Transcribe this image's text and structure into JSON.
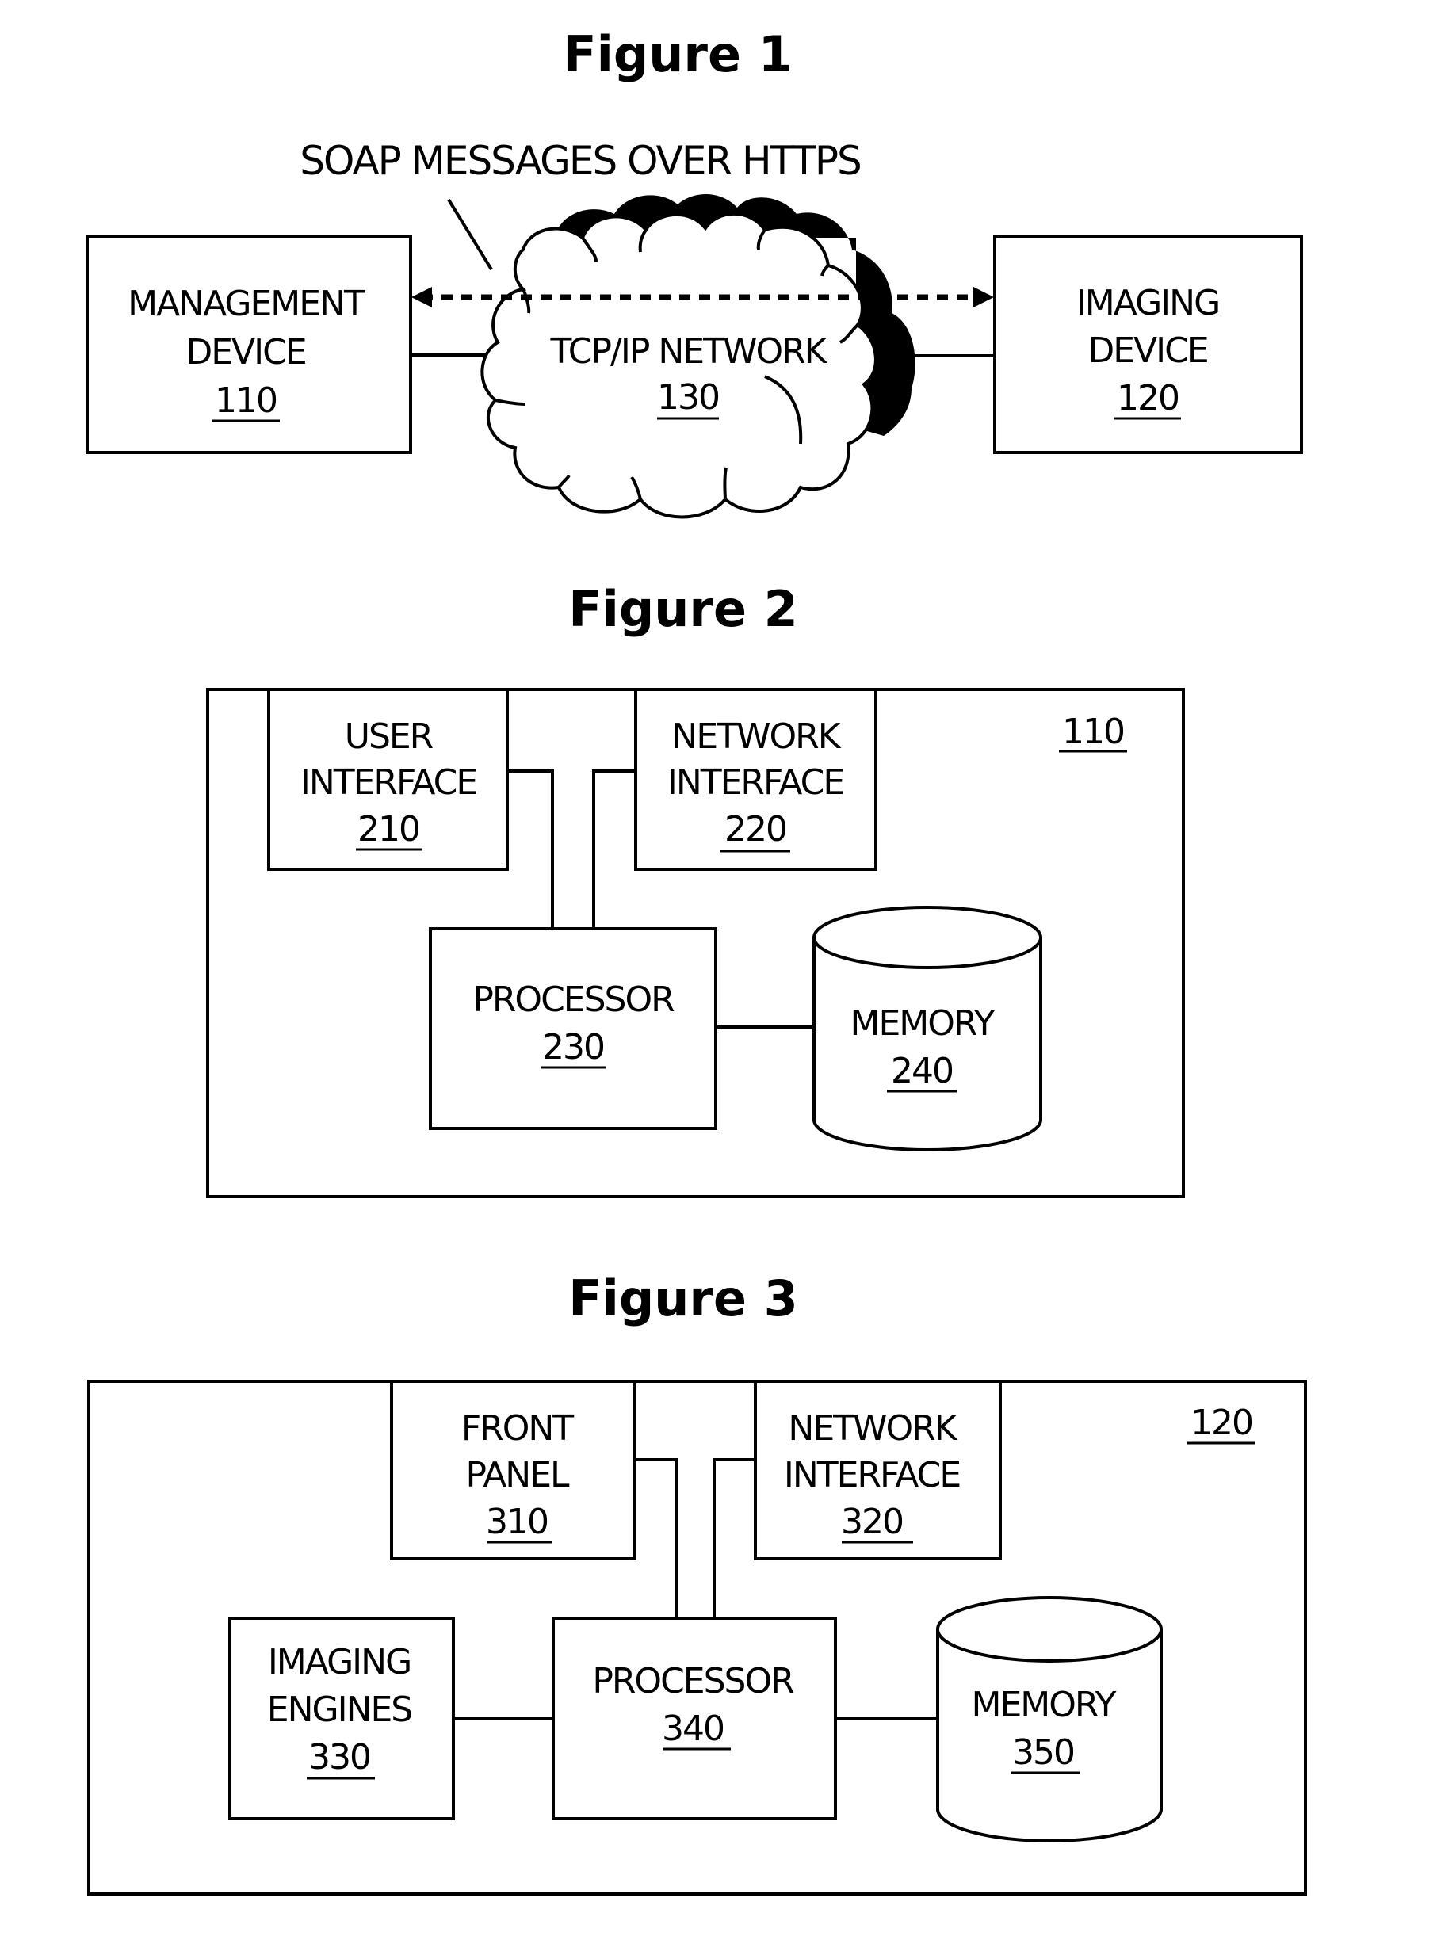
{
  "figures": [
    {
      "title": "Figure 1",
      "annotation": "SOAP MESSAGES OVER HTTPS",
      "nodes": {
        "management_device": {
          "lines": [
            "MANAGEMENT",
            "DEVICE"
          ],
          "ref": "110"
        },
        "network": {
          "lines": [
            "TCP/IP NETWORK"
          ],
          "ref": "130"
        },
        "imaging_device": {
          "lines": [
            "IMAGING",
            "DEVICE"
          ],
          "ref": "120"
        }
      },
      "connections": [
        {
          "from": "management_device",
          "to": "imaging_device",
          "style": "dashed",
          "arrows": "both",
          "meaning": "SOAP MESSAGES OVER HTTPS"
        },
        {
          "from": "management_device",
          "to": "network",
          "style": "solid"
        },
        {
          "from": "network",
          "to": "imaging_device",
          "style": "solid"
        }
      ]
    },
    {
      "title": "Figure 2",
      "container_ref": "110",
      "nodes": {
        "user_interface": {
          "lines": [
            "USER",
            "INTERFACE"
          ],
          "ref": "210"
        },
        "network_interface": {
          "lines": [
            "NETWORK",
            "INTERFACE"
          ],
          "ref": "220"
        },
        "processor": {
          "lines": [
            "PROCESSOR"
          ],
          "ref": "230"
        },
        "memory": {
          "lines": [
            "MEMORY"
          ],
          "ref": "240"
        }
      },
      "connections": [
        {
          "from": "user_interface",
          "to": "processor"
        },
        {
          "from": "network_interface",
          "to": "processor"
        },
        {
          "from": "processor",
          "to": "memory"
        }
      ]
    },
    {
      "title": "Figure 3",
      "container_ref": "120",
      "nodes": {
        "front_panel": {
          "lines": [
            "FRONT",
            "PANEL"
          ],
          "ref": "310"
        },
        "network_interface": {
          "lines": [
            "NETWORK",
            "INTERFACE"
          ],
          "ref": "320"
        },
        "imaging_engines": {
          "lines": [
            "IMAGING",
            "ENGINES"
          ],
          "ref": "330"
        },
        "processor": {
          "lines": [
            "PROCESSOR"
          ],
          "ref": "340"
        },
        "memory": {
          "lines": [
            "MEMORY"
          ],
          "ref": "350"
        }
      },
      "connections": [
        {
          "from": "front_panel",
          "to": "processor"
        },
        {
          "from": "network_interface",
          "to": "processor"
        },
        {
          "from": "imaging_engines",
          "to": "processor"
        },
        {
          "from": "processor",
          "to": "memory"
        }
      ]
    }
  ]
}
